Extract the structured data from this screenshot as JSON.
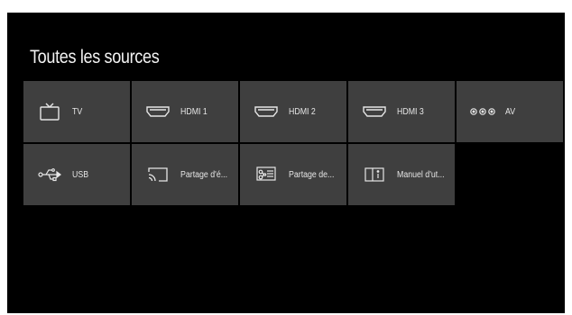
{
  "title": "Toutes les sources",
  "sources": [
    {
      "label": "TV",
      "icon": "tv-icon"
    },
    {
      "label": "HDMI 1",
      "icon": "hdmi-icon"
    },
    {
      "label": "HDMI 2",
      "icon": "hdmi-icon"
    },
    {
      "label": "HDMI 3",
      "icon": "hdmi-icon"
    },
    {
      "label": "AV",
      "icon": "av-icon"
    },
    {
      "label": "USB",
      "icon": "usb-icon"
    },
    {
      "label": "Partage d'é...",
      "icon": "screen-cast-icon"
    },
    {
      "label": "Partage de...",
      "icon": "media-share-icon"
    },
    {
      "label": "Manuel d'ut...",
      "icon": "manual-icon"
    }
  ],
  "colors": {
    "background": "#000000",
    "tile": "#3f3f3f",
    "text": "#e6e6e6"
  }
}
